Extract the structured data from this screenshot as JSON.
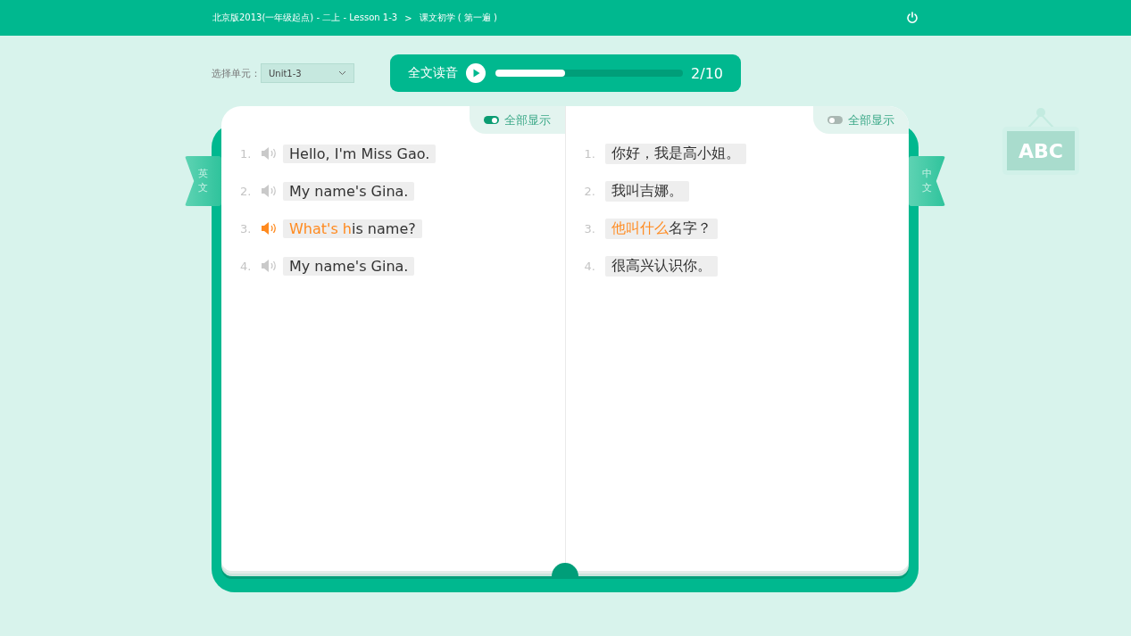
{
  "header": {
    "breadcrumb": "北京版2013(一年级起点) - 二上 - Lesson 1-3",
    "separator": ">",
    "section": "课文初学 ( 第一遍 )"
  },
  "unit_select": {
    "label": "选择单元：",
    "value": "Unit1-3"
  },
  "player": {
    "label": "全文读音",
    "level": 0.37,
    "counter": "2/10"
  },
  "pages": [
    {
      "side_tab": "英文",
      "toggle": {
        "label": "全部显示",
        "on": true
      },
      "has_audio": true,
      "sentences": [
        {
          "num": "1.",
          "playing": false,
          "parts": [
            {
              "text": "Hello, I'm Miss Gao.",
              "active": false
            }
          ]
        },
        {
          "num": "2.",
          "playing": false,
          "parts": [
            {
              "text": "My name's Gina.",
              "active": false
            }
          ]
        },
        {
          "num": "3.",
          "playing": true,
          "parts": [
            {
              "text": "What's h",
              "active": true
            },
            {
              "text": "is name?",
              "active": false
            }
          ]
        },
        {
          "num": "4.",
          "playing": false,
          "parts": [
            {
              "text": "My name's Gina.",
              "active": false
            }
          ]
        }
      ]
    },
    {
      "side_tab": "中文",
      "toggle": {
        "label": "全部显示",
        "on": false
      },
      "has_audio": false,
      "sentences": [
        {
          "num": "1.",
          "parts": [
            {
              "text": "你好，我是高小姐。",
              "active": false
            }
          ]
        },
        {
          "num": "2.",
          "parts": [
            {
              "text": "我叫吉娜。",
              "active": false
            }
          ]
        },
        {
          "num": "3.",
          "parts": [
            {
              "text": "他叫什么",
              "active": true
            },
            {
              "text": "名字？",
              "active": false
            }
          ]
        },
        {
          "num": "4.",
          "parts": [
            {
              "text": "很高兴认识你。",
              "active": false
            }
          ]
        }
      ]
    }
  ],
  "sign": {
    "text": "ABC"
  }
}
